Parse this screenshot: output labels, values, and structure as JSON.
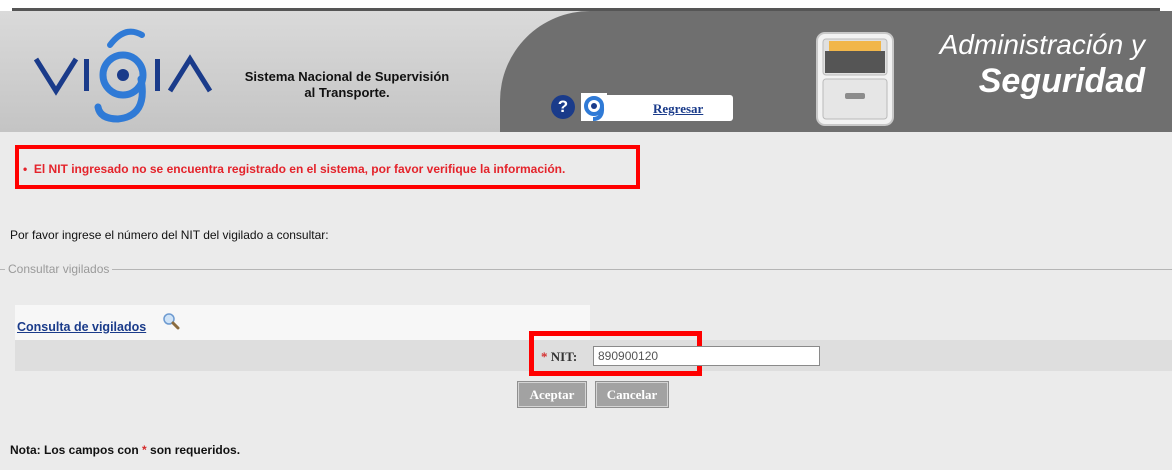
{
  "header": {
    "brand_line1": "Sistema Nacional de Supervisión",
    "brand_line2": "al Transporte.",
    "help_icon": "?",
    "regresar_label": "Regresar",
    "admin_line1": "Administración y",
    "admin_line2": "Seguridad"
  },
  "error": {
    "message": "El NIT ingresado no se encuentra registrado en el sistema, por favor verifique la información."
  },
  "instruction": "Por favor ingrese el número del NIT del vigilado a consultar:",
  "fieldset": {
    "legend": "Consultar vigilados"
  },
  "form": {
    "panel_link": "Consulta de vigilados",
    "required_mark": "*",
    "nit_label": "NIT:",
    "nit_value": "890900120",
    "accept_label": "Aceptar",
    "cancel_label": "Cancelar"
  },
  "note": {
    "prefix": "Nota: Los campos con",
    "required_mark": "*",
    "suffix": "son requeridos."
  },
  "colors": {
    "error_red": "#e4232b",
    "link_blue": "#1a3b8a",
    "button_gray": "#a2a2a2"
  }
}
